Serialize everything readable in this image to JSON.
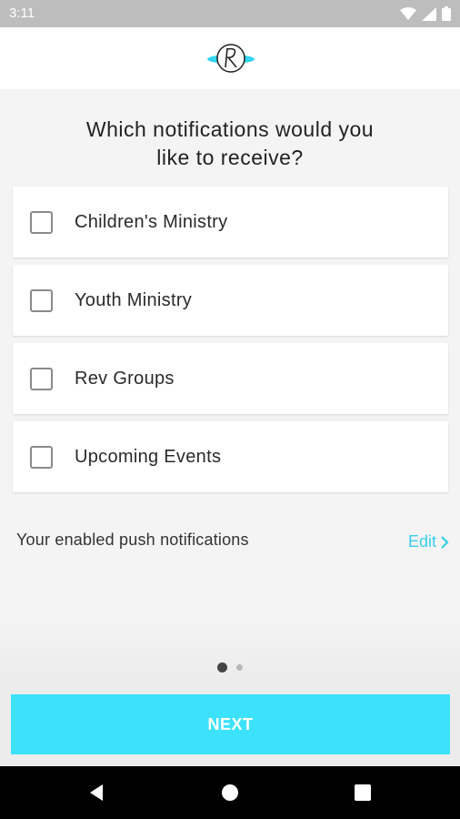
{
  "status_bar": {
    "time": "3:11"
  },
  "header": {
    "logo_icon": "church-logo-icon"
  },
  "title": {
    "line1": "Which notifications would you",
    "line2": "like to receive?"
  },
  "options": [
    {
      "label": "Children's Ministry",
      "checked": false
    },
    {
      "label": "Youth Ministry",
      "checked": false
    },
    {
      "label": "Rev Groups",
      "checked": false
    },
    {
      "label": "Upcoming Events",
      "checked": false
    }
  ],
  "enabled": {
    "text": "Your enabled push notifications",
    "edit_label": "Edit"
  },
  "pager": {
    "current": 1,
    "total": 2
  },
  "next_button": {
    "label": "NEXT"
  },
  "colors": {
    "accent": "#3ce2fb",
    "link": "#38cfe8"
  }
}
